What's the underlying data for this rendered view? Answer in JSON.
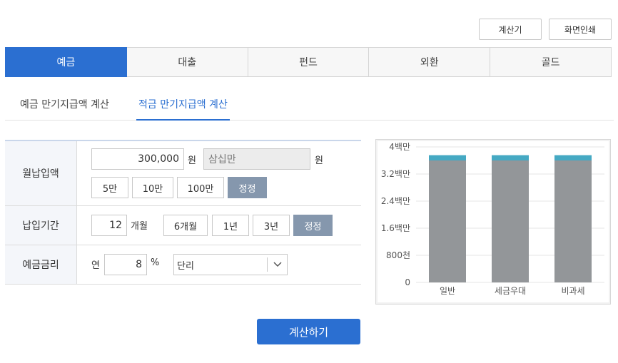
{
  "top_buttons": {
    "calculator": "계산기",
    "print": "화면인쇄"
  },
  "tabs": [
    {
      "label": "예금",
      "active": true
    },
    {
      "label": "대출",
      "active": false
    },
    {
      "label": "펀드",
      "active": false
    },
    {
      "label": "외환",
      "active": false
    },
    {
      "label": "골드",
      "active": false
    }
  ],
  "subtabs": [
    {
      "label": "예금 만기지급액 계산",
      "active": false
    },
    {
      "label": "적금 만기지급액 계산",
      "active": true
    }
  ],
  "form": {
    "monthly": {
      "label": "월납입액",
      "value": "300,000",
      "unit": "원",
      "korean_value": "삼십만",
      "korean_unit": "원",
      "quick": [
        "5만",
        "10만",
        "100만"
      ],
      "reset": "정정"
    },
    "period": {
      "label": "납입기간",
      "value": "12",
      "unit": "개월",
      "quick": [
        "6개월",
        "1년",
        "3년"
      ],
      "reset": "정정"
    },
    "rate": {
      "label": "예금금리",
      "prefix": "연",
      "value": "8",
      "unit": "%",
      "select_value": "단리"
    }
  },
  "submit_label": "계산하기",
  "colors": {
    "accent": "#2b6fd1",
    "bar_principal": "#939699",
    "bar_interest": "#45a9c3",
    "quick_dark": "#8597ad"
  },
  "chart_data": {
    "type": "bar",
    "stacked": true,
    "categories": [
      "일반",
      "세금우대",
      "비과세"
    ],
    "series": [
      {
        "values": [
          3600000,
          3600000,
          3600000
        ],
        "color": "#939699"
      },
      {
        "values": [
          156000,
          156000,
          156000
        ],
        "color": "#45a9c3"
      }
    ],
    "yticks": [
      "0",
      "800천",
      "1.6백만",
      "2.4백만",
      "3.2백만",
      "4백만"
    ],
    "ylim": [
      0,
      4000000
    ],
    "grid": true
  }
}
